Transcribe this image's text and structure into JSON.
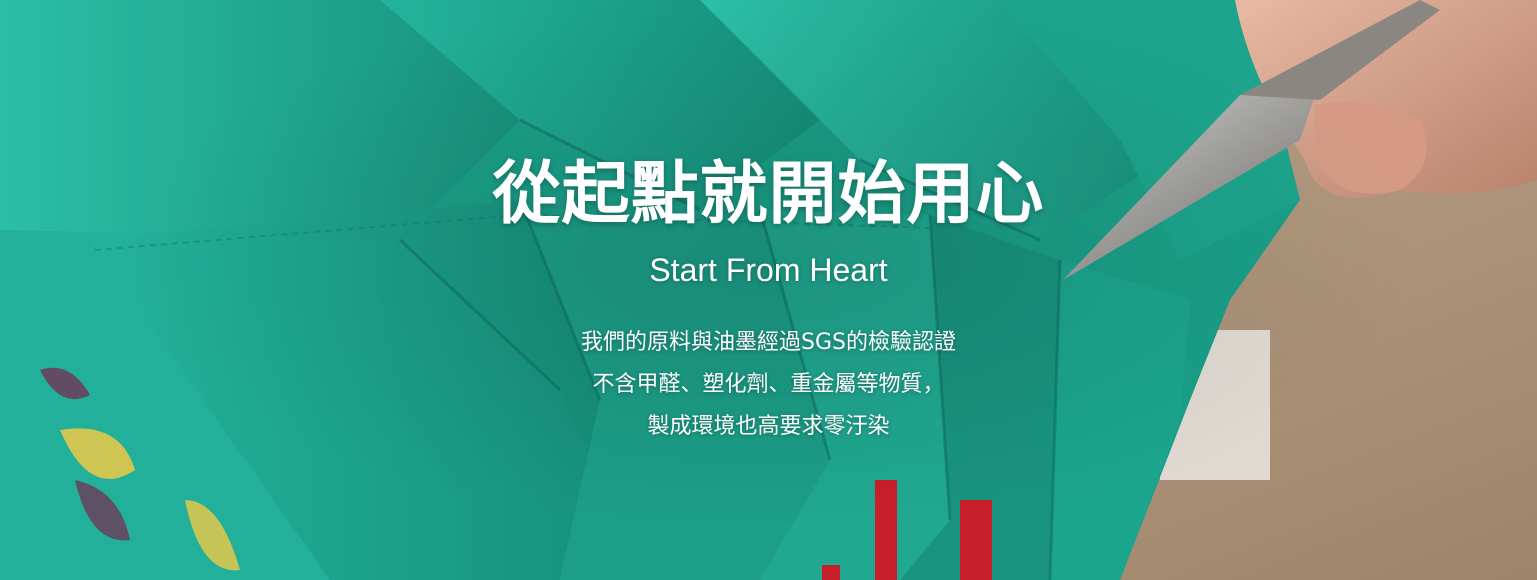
{
  "hero": {
    "title": "從起點就開始用心",
    "subtitle": "Start From Heart",
    "description_lines": [
      "我們的原料與油墨經過SGS的檢驗認證",
      "不含甲醛、塑化劑、重金屬等物質，",
      "製成環境也高要求零汙染"
    ]
  },
  "colors": {
    "fabric_teal": "#1faa93",
    "fabric_dark": "#137a6a",
    "label_red": "#c8202a",
    "background_tan": "#b59b7f",
    "text": "#ffffff"
  }
}
